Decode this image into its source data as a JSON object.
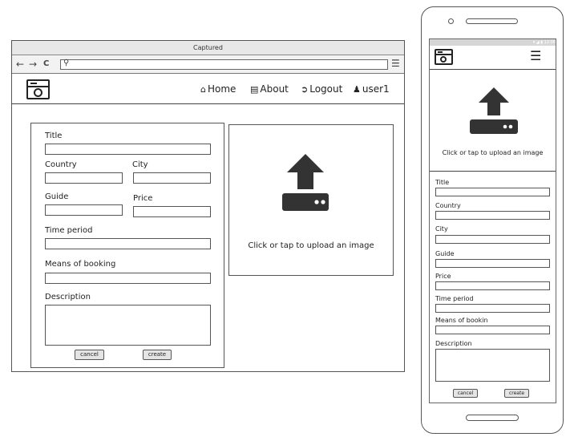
{
  "browser": {
    "title": "Captured",
    "nav": {
      "back": "←",
      "forward": "→",
      "reload": "C"
    },
    "address": {
      "value": "",
      "search_icon": "magnifier-icon"
    },
    "menu_icon": "hamburger-icon"
  },
  "app": {
    "nav": [
      {
        "icon": "home-icon",
        "glyph": "🏠",
        "label": "Home"
      },
      {
        "icon": "book-icon",
        "glyph": "📓",
        "label": "About"
      },
      {
        "icon": "logout-icon",
        "glyph": "⇨",
        "label": "Logout"
      },
      {
        "icon": "user-icon",
        "glyph": "👤",
        "label": "user1"
      }
    ],
    "form": {
      "title_label": "Title",
      "country_label": "Country",
      "city_label": "City",
      "guide_label": "Guide",
      "price_label": "Price",
      "time_label": "Time period",
      "booking_label": "Means of booking",
      "description_label": "Description",
      "cancel_label": "cancel",
      "create_label": "create"
    },
    "upload": {
      "text": "Click or tap to upload an image"
    }
  },
  "phone": {
    "status": "▾ ◢ ▮ 12:00",
    "upload_text": "Click or tap to upload an image",
    "form": {
      "title_label": "Title",
      "country_label": "Country",
      "city_label": "City",
      "guide_label": "Guide",
      "price_label": "Price",
      "time_label": "Time period",
      "booking_label": "Means of bookin",
      "description_label": "Description",
      "cancel_label": "cancel",
      "create_label": "create"
    }
  }
}
